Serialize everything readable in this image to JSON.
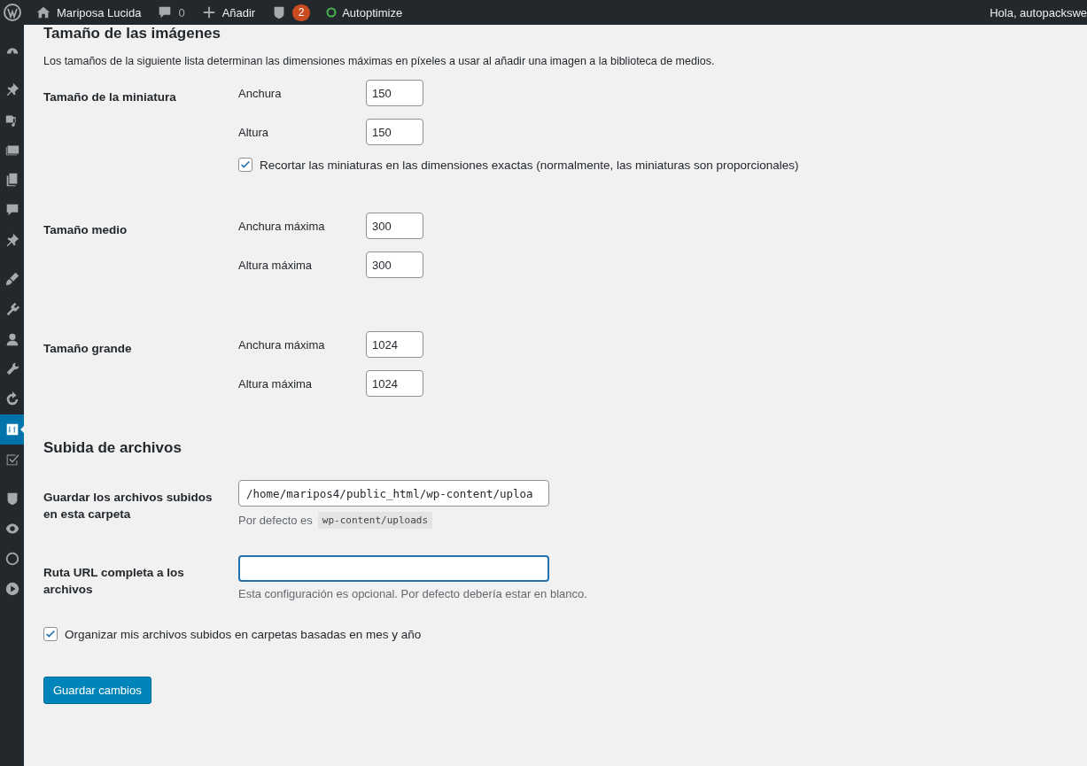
{
  "admin_bar": {
    "site": "Mariposa Lucida",
    "comments": "0",
    "add_new": "Añadir",
    "seo_count": "2",
    "plugin": "Autoptimize",
    "greeting": "Hola, autopackswe"
  },
  "sidebar": {
    "groups": [
      {
        "items": [
          {
            "selected": false
          }
        ]
      },
      {
        "items": [
          {
            "selected": false
          },
          {
            "selected": false
          },
          {
            "selected": false
          },
          {
            "selected": false
          },
          {
            "selected": false
          },
          {
            "selected": false
          }
        ]
      },
      {
        "items": [
          {
            "selected": false
          },
          {
            "selected": false
          },
          {
            "selected": false
          },
          {
            "selected": false
          },
          {
            "selected": false
          },
          {
            "selected": true
          },
          {
            "selected": false
          }
        ]
      },
      {
        "items": [
          {
            "selected": false
          },
          {
            "selected": false
          },
          {
            "selected": false
          },
          {
            "selected": false
          }
        ]
      }
    ]
  },
  "sections": [
    {
      "title": "Tamaño de las imágenes",
      "description": "Los tamaños de la siguiente lista determinan las dimensiones máximas en píxeles a usar al añadir una imagen a la biblioteca de medios.",
      "rows": [
        {
          "kind": "dimensions",
          "label": "Tamaño de la miniatura",
          "fields": [
            {
              "label": "Anchura",
              "value": "150"
            },
            {
              "label": "Altura",
              "value": "150"
            }
          ],
          "checkbox": {
            "label": "Recortar las miniaturas en las dimensiones exactas (normalmente, las miniaturas son proporcionales)",
            "checked": true
          }
        },
        {
          "kind": "dimensions",
          "label": "Tamaño medio",
          "fields": [
            {
              "label": "Anchura máxima",
              "value": "300"
            },
            {
              "label": "Altura máxima",
              "value": "300"
            }
          ]
        },
        {
          "kind": "dimensions",
          "label": "Tamaño grande",
          "fields": [
            {
              "label": "Anchura máxima",
              "value": "1024"
            },
            {
              "label": "Altura máxima",
              "value": "1024"
            }
          ]
        }
      ]
    },
    {
      "title": "Subida de archivos",
      "rows": [
        {
          "kind": "text",
          "label": "Guardar los archivos subidos en esta carpeta",
          "value": "/home/maripos4/public_html/wp-content/uploa",
          "focused": false,
          "note": "Por defecto es",
          "note_code": "wp-content/uploads"
        },
        {
          "kind": "text",
          "label": "Ruta URL completa a los archivos",
          "focused": true,
          "note": "Esta configuración es opcional. Por defecto debería estar en blanco."
        }
      ]
    }
  ],
  "organize": {
    "label": "Organizar mis archivos subidos en carpetas basadas en mes y año",
    "checked": true
  },
  "save_button": "Guardar cambios"
}
